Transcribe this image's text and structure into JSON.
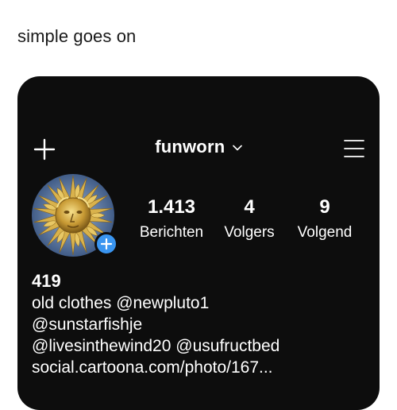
{
  "caption": "simple goes on",
  "header": {
    "username": "funworn"
  },
  "profile": {
    "stats": [
      {
        "value": "1.413",
        "label": "Berichten"
      },
      {
        "value": "4",
        "label": "Volgers"
      },
      {
        "value": "9",
        "label": "Volgend"
      }
    ],
    "name": "419",
    "bio": {
      "line1_text": "old clothes ",
      "mention1": "@newpluto1",
      "mention2": "@sunstarfishje",
      "mention3": "@livesinthewind20",
      "mention4": "@usufructbed",
      "link": "social.cartoona.com/photo/167..."
    }
  },
  "icons": {
    "create": "plus-icon",
    "account_switcher": "chevron-down-icon",
    "menu": "hamburger-menu-icon",
    "add_story": "add-story-plus-icon"
  },
  "colors": {
    "background": "#0d0d0d",
    "accent_blue": "#3a95f0",
    "text": "#ffffff"
  }
}
